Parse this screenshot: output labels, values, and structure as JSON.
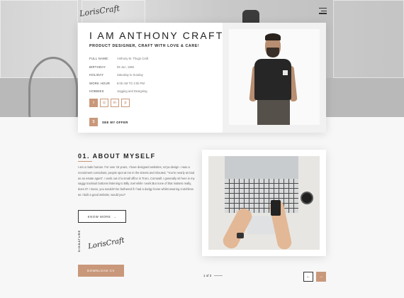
{
  "header": {
    "logo_text": "LorisCraft",
    "menu_icon": "hamburger-menu-icon"
  },
  "profile": {
    "name": "I AM ANTHONY CRAFT",
    "tagline": "PRODUCT DESIGNER, CRAFT WITH LOVE & CARE!",
    "info": [
      {
        "label": "FULL NAME:",
        "value": "Anthony M. Thugs Craft"
      },
      {
        "label": "BIRTHDAY",
        "value": "05 Jun, 1982"
      },
      {
        "label": "HOLIDAY",
        "value": "Saturday to Sunday"
      },
      {
        "label": "WORK HOUR",
        "value": "8:00 AM TO 4:00 PM"
      },
      {
        "label": "HOBBIES",
        "value": "Jogging and Designing"
      }
    ],
    "socials": [
      {
        "icon": "twitter-icon",
        "glyph": "t"
      },
      {
        "icon": "github-icon",
        "glyph": "◎"
      },
      {
        "icon": "linkedin-icon",
        "glyph": "in"
      },
      {
        "icon": "pinterest-icon",
        "glyph": "p"
      }
    ],
    "offer_label": "SEE MY OFFER",
    "offer_glyph": "$"
  },
  "about": {
    "title": "01. ABOUT MYSELF",
    "body": "I am a male human. For over 15 years, I have designed websites, so'ya design. I was a recruitment consultant, people spot at me in the streets and shouted, \"You're nearly as bad as an estate agent\". I work out of a small office in Truro, Cornwall. I generally sit here in my saggy tracksuit bottoms listening to Billy Joel while I work.But none of that matters really, does it? I mean, you wouldn't be bothered if I had a dodgy horse whilst wearing crotchless as I built a good website, would you?",
    "know_more_label": "KNOW MORE",
    "know_more_arrow": "→",
    "vertical_text": "SIGNATURE",
    "signature_text": "LorisCraft",
    "download_label": "DOWNLOAD CV"
  },
  "pagination": {
    "current": "1 of 3",
    "prev_glyph": "←",
    "next_glyph": "→"
  },
  "colors": {
    "accent": "#c9987a",
    "text_dark": "#222222"
  }
}
